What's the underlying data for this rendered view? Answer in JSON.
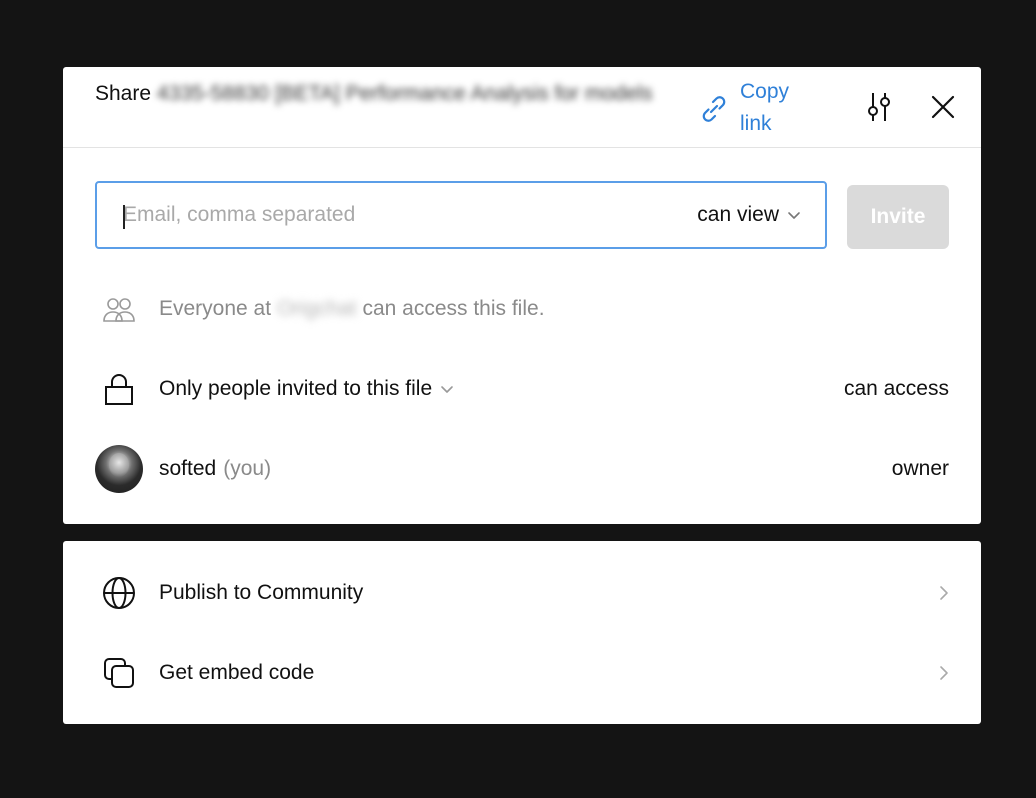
{
  "dialog": {
    "title_prefix": "Share",
    "file_name": "4335-58830 [BETA] Performance Analysis for models",
    "copy_link_label": "Copy link"
  },
  "invite": {
    "placeholder": "Email, comma separated",
    "value": "",
    "permission": "can view",
    "invite_label": "Invite"
  },
  "access": {
    "team_prefix": "Everyone at",
    "org_name": "Origchat",
    "team_suffix": "can access this file.",
    "link_scope": "Only people invited to this file",
    "link_permission": "can access"
  },
  "members": [
    {
      "name": "softed",
      "tag": "(you)",
      "role": "owner"
    }
  ],
  "publish": {
    "items": [
      {
        "label": "Publish to Community",
        "icon": "globe-icon"
      },
      {
        "label": "Get embed code",
        "icon": "embed-icon"
      }
    ]
  },
  "colors": {
    "accent": "#2f80d8",
    "focus_border": "#5b9ee8",
    "backdrop": "#141414",
    "disabled_button": "#dadada"
  }
}
